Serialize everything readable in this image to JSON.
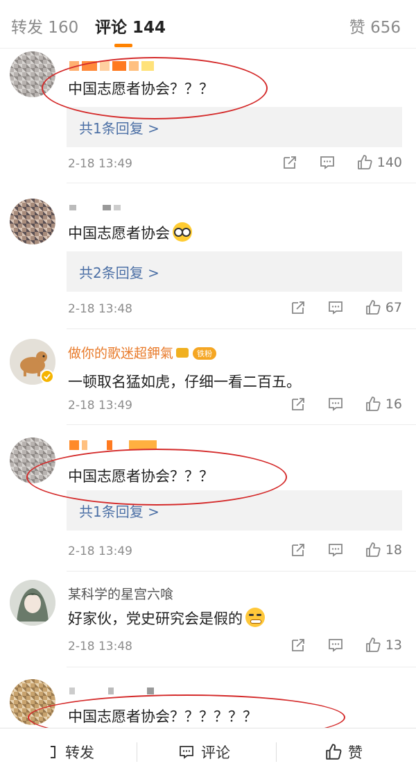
{
  "tabs": {
    "repost": "转发 160",
    "comment": "评论 144",
    "like": "赞 656"
  },
  "comments": [
    {
      "text": "中国志愿者协会？？？",
      "reply": "共1条回复 >",
      "time": "2-18 13:49",
      "likes": "140"
    },
    {
      "text": "中国志愿者协会",
      "reply": "共2条回复 >",
      "time": "2-18 13:48",
      "likes": "67"
    },
    {
      "user": "做你的歌迷超鉀氣",
      "badge": "铁粉",
      "text": "一顿取名猛如虎，仔细一看二百五。",
      "time": "2-18 13:49",
      "likes": "16"
    },
    {
      "text": "中国志愿者协会？？？",
      "reply": "共1条回复 >",
      "time": "2-18 13:49",
      "likes": "18"
    },
    {
      "user": "某科学的星宫六喰",
      "text": "好家伙，党史研究会是假的",
      "time": "2-18 13:48",
      "likes": "13"
    },
    {
      "text": "中国志愿者协会？？？？？？"
    }
  ],
  "bottom": {
    "repost": "转发",
    "comment": "评论",
    "like": "赞"
  },
  "colors": {
    "accent": "#ff8200",
    "link": "#4b6fa5",
    "annotation": "#d42a2a"
  }
}
